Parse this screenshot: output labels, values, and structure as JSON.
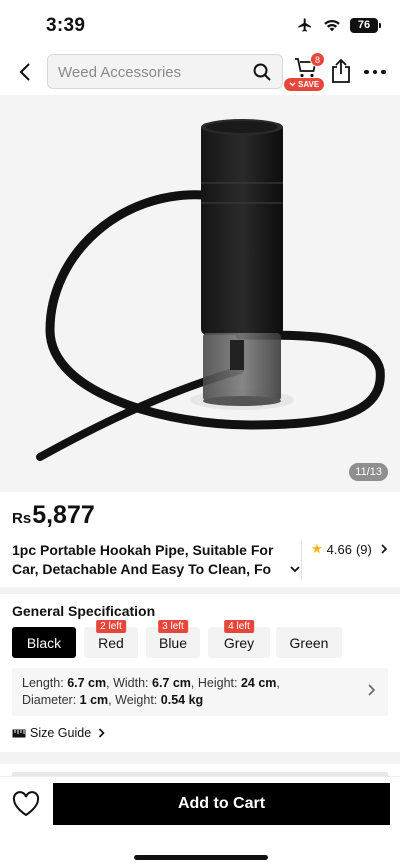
{
  "status_bar": {
    "time": "3:39",
    "battery": "76",
    "icons": [
      "airplane-icon",
      "wifi-icon",
      "battery-icon"
    ]
  },
  "nav": {
    "search_placeholder": "Weed Accessories",
    "cart_count": "8",
    "save_label": "SAVE",
    "icons": [
      "back-icon",
      "search-icon",
      "cart-icon",
      "share-icon",
      "more-icon"
    ]
  },
  "product": {
    "image_counter": "11/13",
    "currency": "Rs",
    "price": "5,877",
    "title_line1": "1pc Portable Hookah Pipe, Suitable For",
    "title_line2": "Car, Detachable And Easy To Clean, Fo",
    "rating": "4.66",
    "reviews": "(9)"
  },
  "spec": {
    "heading": "General Specification",
    "colors": [
      {
        "label": "Black",
        "selected": true,
        "stock": ""
      },
      {
        "label": "Red",
        "selected": false,
        "stock": "2 left"
      },
      {
        "label": "Blue",
        "selected": false,
        "stock": "3 left"
      },
      {
        "label": "Grey",
        "selected": false,
        "stock": "4 left"
      },
      {
        "label": "Green",
        "selected": false,
        "stock": ""
      }
    ],
    "dims": {
      "length_label": "Length:",
      "length": "6.7 cm",
      "width_label": "Width:",
      "width": "6.7 cm",
      "height_label": "Height:",
      "height": "24 cm",
      "diameter_label": "Diameter:",
      "diameter": "1 cm",
      "weight_label": "Weight:",
      "weight": "0.54 kg"
    },
    "size_guide": "Size Guide"
  },
  "bottom": {
    "add_to_cart": "Add to Cart"
  },
  "colors": {
    "accent": "#e7473a",
    "primary_button": "#000000",
    "star": "#f5b301"
  }
}
